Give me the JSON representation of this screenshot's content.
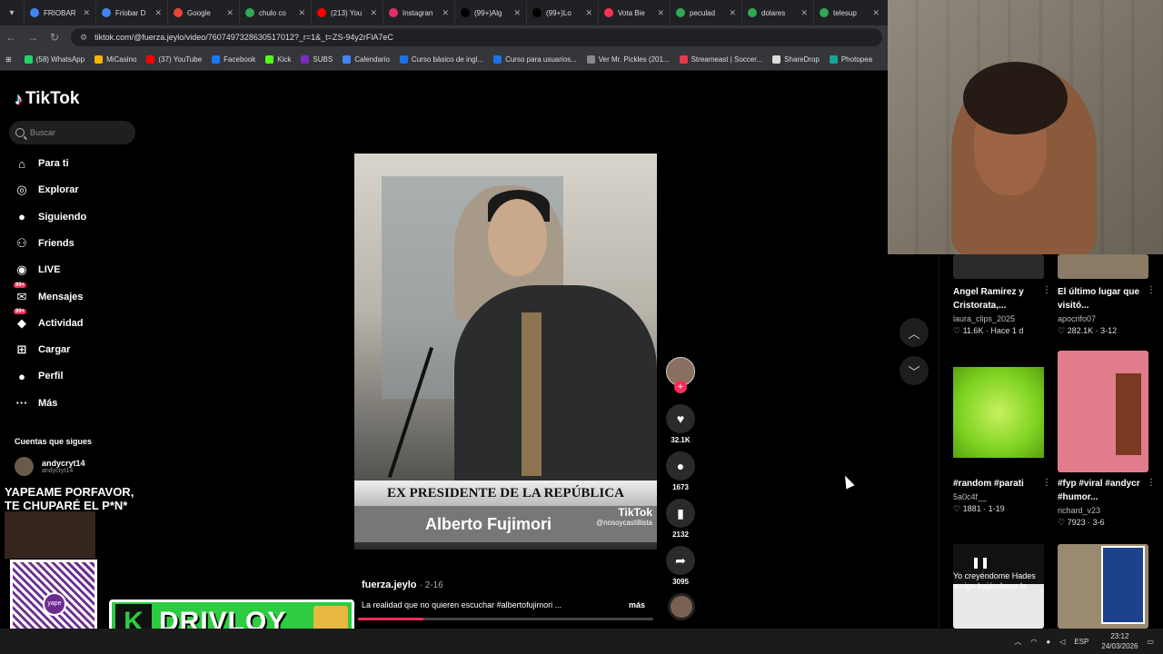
{
  "browser": {
    "tabs": [
      {
        "label": "FRIOBAR",
        "color": "#4285f4"
      },
      {
        "label": "Friobar D",
        "color": "#4285f4"
      },
      {
        "label": "Google",
        "color": "#ea4335"
      },
      {
        "label": "chulo co",
        "color": "#34a853"
      },
      {
        "label": "(213) You",
        "color": "#ff0000"
      },
      {
        "label": "Instagran",
        "color": "#e1306c"
      },
      {
        "label": "(99+)Alg",
        "color": "#000000"
      },
      {
        "label": "(99+)Lo",
        "color": "#000000"
      },
      {
        "label": "Vota Bie",
        "color": "#ff3355"
      },
      {
        "label": "peculad",
        "color": "#34a853"
      },
      {
        "label": "dolares",
        "color": "#34a853"
      },
      {
        "label": "telesup",
        "color": "#34a853"
      }
    ],
    "url": "tiktok.com/@fuerza.jeylo/video/7607497328630517012?_r=1&_t=ZS-94y2rFlA7eC",
    "bookmarks": [
      {
        "label": "(58) WhatsApp",
        "color": "#25d366"
      },
      {
        "label": "MiCasino",
        "color": "#f4b400"
      },
      {
        "label": "(37) YouTube",
        "color": "#ff0000"
      },
      {
        "label": "Facebook",
        "color": "#1877f2"
      },
      {
        "label": "Kick",
        "color": "#53fc18"
      },
      {
        "label": "SUBS",
        "color": "#7b2cbf"
      },
      {
        "label": "Calendario",
        "color": "#4285f4"
      },
      {
        "label": "Curso básico de ingl...",
        "color": "#1a73e8"
      },
      {
        "label": "Curso para usuarios...",
        "color": "#1a73e8"
      },
      {
        "label": "Ver Mr. Pickles (201...",
        "color": "#888888"
      },
      {
        "label": "Streameast | Soccer...",
        "color": "#e63946"
      },
      {
        "label": "ShareDrop",
        "color": "#dddddd"
      },
      {
        "label": "Photopea",
        "color": "#18a497"
      }
    ]
  },
  "tiktok": {
    "logo": "TikTok",
    "search_placeholder": "Buscar",
    "nav": [
      {
        "label": "Para ti",
        "icon": "home-icon",
        "glyph": "⌂"
      },
      {
        "label": "Explorar",
        "icon": "compass-icon",
        "glyph": "◎"
      },
      {
        "label": "Siguiendo",
        "icon": "following-icon",
        "glyph": "●"
      },
      {
        "label": "Friends",
        "icon": "friends-icon",
        "glyph": "⚇"
      },
      {
        "label": "LIVE",
        "icon": "live-icon",
        "glyph": "◉"
      },
      {
        "label": "Mensajes",
        "icon": "messages-icon",
        "glyph": "✉",
        "badge": "99+"
      },
      {
        "label": "Actividad",
        "icon": "activity-icon",
        "glyph": "◆",
        "badge": "99+"
      },
      {
        "label": "Cargar",
        "icon": "upload-icon",
        "glyph": "⊞"
      },
      {
        "label": "Perfil",
        "icon": "profile-icon",
        "glyph": "●"
      },
      {
        "label": "Más",
        "icon": "more-icon",
        "glyph": "···"
      }
    ],
    "following_title": "Cuentas que sigues",
    "following": [
      {
        "name": "andycryt14",
        "handle": "andycryt14"
      }
    ],
    "video": {
      "caption_line1": "EX PRESIDENTE DE LA REPÚBLICA",
      "caption_line2": "Alberto Fujimori",
      "watermark": "TikTok",
      "watermark_handle": "@nosoycastillista",
      "author": "fuerza.jeylo",
      "date": "2-16",
      "description": "La realidad que no quieren escuchar #albertofujimori ...",
      "more": "más",
      "progress": 0.22
    },
    "actions": {
      "likes": "32.1K",
      "comments": "1673",
      "saves": "2132",
      "shares": "3095"
    },
    "recommended": [
      {
        "title": "Angel Ramirez y Cristorata,...",
        "user": "laura_clips_2025",
        "stats": "♡ 11.6K · Hace 1 d"
      },
      {
        "title": "El último lugar que visitó...",
        "user": "apocrifo07",
        "stats": "♡ 282.1K · 3-12"
      },
      {
        "title": "#random #parati",
        "user": "5a0c4f__",
        "stats": "♡ 1881 · 1-19"
      },
      {
        "title": "#fyp #viral #andycr #humor...",
        "user": "richard_v23",
        "stats": "♡ 7923 · 3-6"
      }
    ],
    "bottom_thumb_text": "Yo creyéndome Hades amigo bajándome la"
  },
  "stream": {
    "overlay_text": "YAPEAME PORFAVOR, TE CHUPARÉ  EL P*N*",
    "qr_label": "yape",
    "brand": "DRIVLOY",
    "brand_k": "K"
  },
  "taskbar": {
    "lang": "ESP",
    "time": "23:12",
    "date": "24/03/2026"
  }
}
